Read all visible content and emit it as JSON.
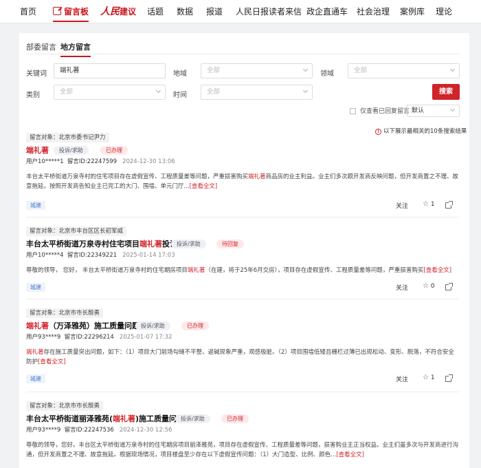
{
  "nav": {
    "items": [
      "首页",
      "留言板",
      "话题",
      "数据",
      "报道",
      "人民日报读者来信",
      "政企直通车",
      "社会治理",
      "案例库",
      "理论"
    ],
    "logo_mark": "人民",
    "logo_rest": "建议"
  },
  "tabs": [
    "部委留言",
    "地方留言"
  ],
  "filters": {
    "keyword_label": "关键词",
    "keyword_value": "端礼著",
    "region_label": "地域",
    "region_placeholder": "全部",
    "field_label": "领域",
    "field_placeholder": "全部",
    "category_label": "类别",
    "category_placeholder": "全部",
    "time_label": "时间",
    "time_placeholder": "全部",
    "search_button": "搜索",
    "only_replied": "仅查看已回复留言",
    "sort_value": "默认",
    "result_info": "以下展示最相关的10条搜索结果"
  },
  "results": [
    {
      "target": "留言对象：北京市委书记尹力",
      "title_hl": "端礼著",
      "title_rest": "",
      "type_tag": "投诉/求助",
      "status_tag": "已办理",
      "user": "用户10*****1",
      "msg_id": "留言ID:22247599",
      "date": "2024-12-30 13:06",
      "body_pre": "丰台太平桥街道万泉寺村的住宅项目存在虚假宣传、工程质量差等问题，严重损害购买",
      "body_hl": "端礼著",
      "body_post": "商品房的业主利益。业主们多次跟开发商反映问题，但开发商置之不理、故意拖延。按照开发商告知业主已完工的大门、围墙、单元门厅...",
      "more": "[查看全文]",
      "category": "城建",
      "follow": "关注",
      "likes": "1"
    },
    {
      "target": "留言对象：北京市丰台区区长初军威",
      "title_pre": "丰台太平桥街道万泉寺村住宅项目",
      "title_hl": "端礼著",
      "title_post": "投诉",
      "type_tag": "投诉/求助",
      "status_tag": "待回复",
      "user": "用户10*****4",
      "msg_id": "留言ID:22349221",
      "date": "2025-01-14 17:03",
      "body_pre": "尊敬的领导，  您好， 丰台太平桥街道万泉寺村的住宅期房项目",
      "body_hl": "端礼著",
      "body_post": "（在建，将于25年6月交房），项目存在虚假宣传、工程质量差等问题，严重损害购买",
      "more": "[查看全文]",
      "category": "城建",
      "follow": "关注",
      "likes": "0"
    },
    {
      "target": "留言对象：北京市市长殷勇",
      "title_hl": "端礼著",
      "title_post": "（万泽雅苑）施工质量问题",
      "type_tag": "投诉/求助",
      "status_tag": "已办理",
      "user": "用户93****9",
      "msg_id": "留言ID:22296214",
      "date": "2025-01-07 17:32",
      "body_hl": "端礼著",
      "body_post": "存在施工质量突出问题，如下：（1）项目大门前场勾缝不平整、返碱现象严重，观感极脏。（2）项目围墙低矮且栅栏过薄已出现松动、变形、脱落，不符合安全防护",
      "more": "[查看全文]",
      "category": "城建",
      "follow": "关注",
      "likes": "1"
    },
    {
      "target": "留言对象：北京市市长殷勇",
      "title_pre": "丰台太平桥街道丽泽雅苑(",
      "title_hl": "端礼著",
      "title_post": ")施工质量问题",
      "type_tag": "投诉/求助",
      "status_tag": "已办理",
      "user": "用户93****9",
      "msg_id": "留言ID:22247536",
      "date": "2024-12-30 12:56",
      "body_pre": "尊敬的领导，您好。丰台区太平桥街道万泉寺村的住宅期房项目丽泽雅苑，项目存在虚假宣传、工程质量差等问题，损害购业主正当权益。业主们虽多次与开发商进行沟通，但开发商置之不理、故意拖延。根据现场情况，项目楼盘至少存在以下虚假宣传问题：（1）大门造型、比例、颜色...",
      "more": "[查看全文]"
    }
  ],
  "colors": {
    "brand_red": "#d0232a",
    "tag_blue": "#4a7bd0"
  },
  "icons": [
    "edit-icon",
    "chevron-down-icon",
    "info-icon",
    "star-icon",
    "share-icon"
  ]
}
